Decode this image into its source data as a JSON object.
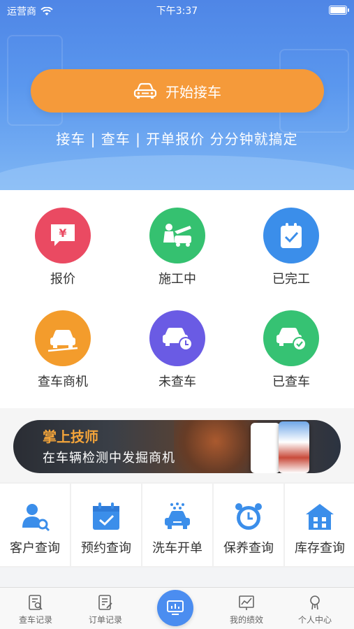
{
  "status_bar": {
    "carrier": "运营商",
    "time": "下午3:37"
  },
  "hero": {
    "start_button_label": "开始接车",
    "slogan": "接车 | 查车 | 开单报价  分分钟就搞定"
  },
  "functions": [
    {
      "label": "报价",
      "icon": "quote-icon",
      "color": "#ea4a62"
    },
    {
      "label": "施工中",
      "icon": "repair-in-progress-icon",
      "color": "#35c170"
    },
    {
      "label": "已完工",
      "icon": "completed-checklist-icon",
      "color": "#3b8eea"
    },
    {
      "label": "查车商机",
      "icon": "car-opportunity-icon",
      "color": "#f39c2c"
    },
    {
      "label": "未查车",
      "icon": "car-pending-check-icon",
      "color": "#6a5be4"
    },
    {
      "label": "已查车",
      "icon": "car-checked-icon",
      "color": "#36c273"
    }
  ],
  "banner": {
    "title": "掌上技师",
    "subtitle": "在车辆检测中发掘商机"
  },
  "quick_actions": [
    {
      "label": "客户查询",
      "icon": "customer-search-icon"
    },
    {
      "label": "预约查询",
      "icon": "appointment-calendar-icon"
    },
    {
      "label": "洗车开单",
      "icon": "car-wash-icon"
    },
    {
      "label": "保养查询",
      "icon": "maintenance-clock-icon"
    },
    {
      "label": "库存查询",
      "icon": "inventory-warehouse-icon"
    }
  ],
  "tabbar": [
    {
      "label": "查车记录",
      "icon": "car-record-icon"
    },
    {
      "label": "订单记录",
      "icon": "order-record-icon"
    },
    {
      "label": "",
      "icon": "center-monitor-icon"
    },
    {
      "label": "我的绩效",
      "icon": "performance-chart-icon"
    },
    {
      "label": "个人中心",
      "icon": "profile-icon"
    }
  ],
  "colors": {
    "accent_blue": "#3b8eea",
    "orange": "#f59a3a",
    "hero_top": "#4f86e6"
  }
}
